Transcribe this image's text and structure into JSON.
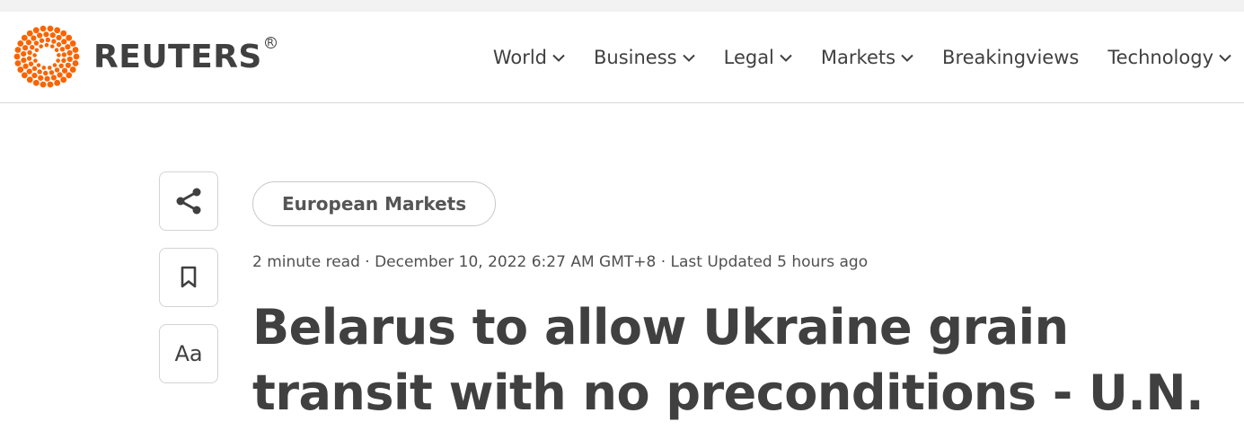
{
  "brand": {
    "name": "REUTERS",
    "registered": "R",
    "color": "#fa6400"
  },
  "nav": {
    "items": [
      {
        "label": "World",
        "dropdown": true
      },
      {
        "label": "Business",
        "dropdown": true
      },
      {
        "label": "Legal",
        "dropdown": true
      },
      {
        "label": "Markets",
        "dropdown": true
      },
      {
        "label": "Breakingviews",
        "dropdown": false
      },
      {
        "label": "Technology",
        "dropdown": true
      }
    ]
  },
  "toolbar": {
    "share_icon": "share-icon",
    "bookmark_icon": "bookmark-icon",
    "text_size_label": "Aa"
  },
  "article": {
    "category": "European Markets",
    "meta": "2 minute read · December 10, 2022 6:27 AM GMT+8 · Last Updated 5 hours ago",
    "headline": "Belarus to allow Ukraine grain transit with no preconditions - U.N."
  }
}
